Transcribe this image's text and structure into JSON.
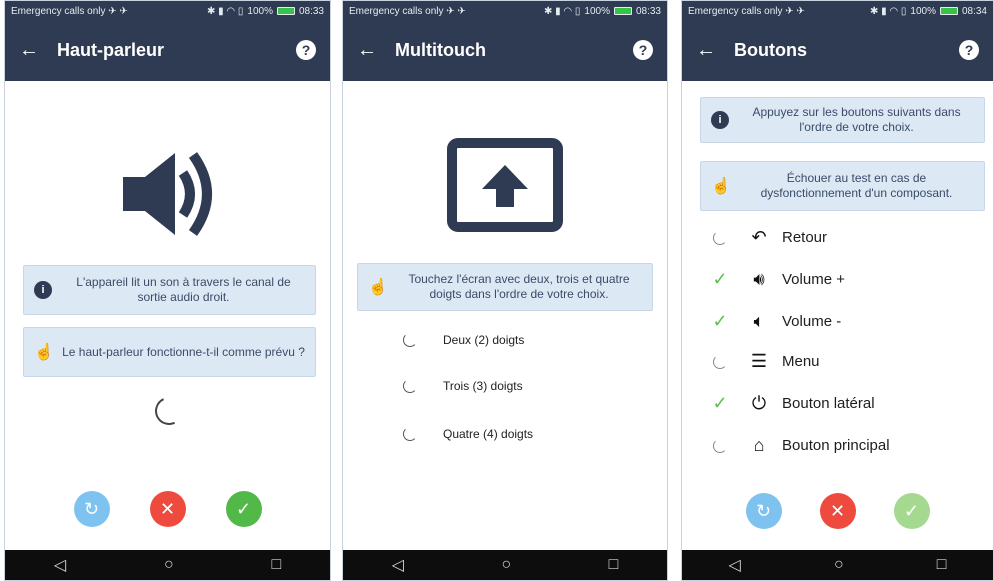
{
  "status": {
    "left": "Emergency calls only ✈ ✈",
    "battery": "100%",
    "time": "08:33",
    "time3": "08:34"
  },
  "screen1": {
    "title": "Haut-parleur",
    "info": "L'appareil lit un son à travers le canal de sortie audio droit.",
    "question": "Le haut-parleur fonctionne-t-il comme prévu ?"
  },
  "screen2": {
    "title": "Multitouch",
    "info": "Touchez l'écran avec deux, trois et quatre doigts dans l'ordre de votre choix.",
    "options": [
      "Deux (2) doigts",
      "Trois (3) doigts",
      "Quatre (4) doigts"
    ]
  },
  "screen3": {
    "title": "Boutons",
    "info": "Appuyez sur les boutons suivants dans l'ordre de votre choix.",
    "fail": "Échouer au test en cas de dysfonctionnement d'un composant.",
    "buttons": [
      {
        "label": "Retour",
        "status": "pending",
        "icon": "back-arrow-icon"
      },
      {
        "label": "Volume +",
        "status": "done",
        "icon": "volume-up-icon"
      },
      {
        "label": "Volume -",
        "status": "done",
        "icon": "volume-down-icon"
      },
      {
        "label": "Menu",
        "status": "pending",
        "icon": "menu-icon"
      },
      {
        "label": "Bouton latéral",
        "status": "done",
        "icon": "power-icon"
      },
      {
        "label": "Bouton principal",
        "status": "pending",
        "icon": "home-icon"
      }
    ]
  },
  "colors": {
    "appbar": "#2f3b52",
    "card": "#dce9f4",
    "retry": "#7ec3ef",
    "fail": "#ee4b3e",
    "pass": "#52b848",
    "pass_disabled": "#a4d98f",
    "check": "#5cc04f"
  }
}
